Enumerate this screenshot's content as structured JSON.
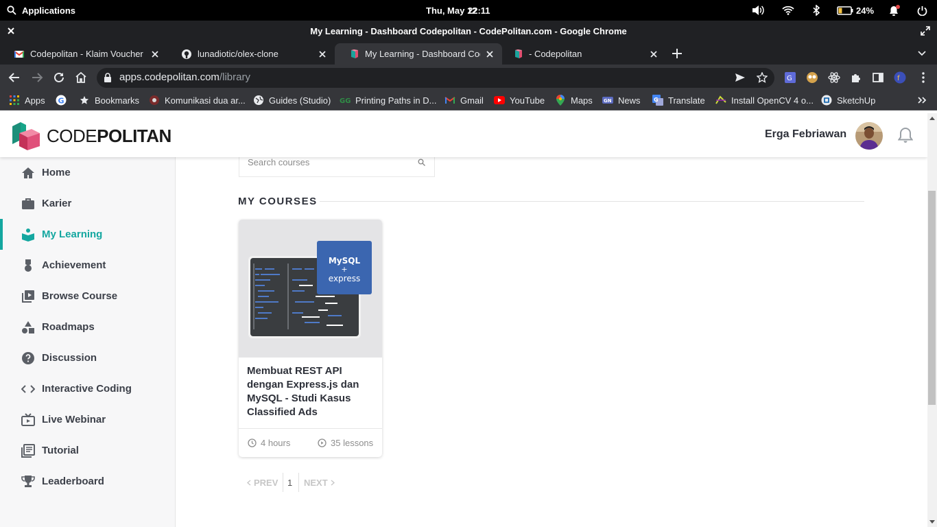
{
  "os_bar": {
    "apps_label": "Applications",
    "date": "Thu, May 12",
    "time": "22:11",
    "battery": "24%"
  },
  "window": {
    "title": "My Learning - Dashboard Codepolitan - CodePolitan.com - Google Chrome"
  },
  "tabs": [
    {
      "label": "Codepolitan - Klaim Voucher - C",
      "icon": "gmail-icon"
    },
    {
      "label": "lunadiotic/olex-clone",
      "icon": "github-icon"
    },
    {
      "label": "My Learning - Dashboard Codepolitan",
      "icon": "codepolitan-icon",
      "active": true
    },
    {
      "label": "- Codepolitan",
      "icon": "codepolitan-icon"
    }
  ],
  "address_bar": {
    "host": "apps.codepolitan.com",
    "path": "/library"
  },
  "bookmarks": [
    {
      "label": "Apps",
      "icon": "apps-grid-icon"
    },
    {
      "label": "",
      "icon": "google-icon"
    },
    {
      "label": "Bookmarks",
      "icon": "star-icon"
    },
    {
      "label": "Komunikasi dua ar...",
      "icon": "bookmark-favicon"
    },
    {
      "label": "Guides (Studio)",
      "icon": "globe-icon"
    },
    {
      "label": "Printing Paths in D...",
      "icon": "gfg-icon"
    },
    {
      "label": "Gmail",
      "icon": "gmail-icon"
    },
    {
      "label": "YouTube",
      "icon": "youtube-icon"
    },
    {
      "label": "Maps",
      "icon": "maps-icon"
    },
    {
      "label": "News",
      "icon": "news-icon"
    },
    {
      "label": "Translate",
      "icon": "translate-icon"
    },
    {
      "label": "Install OpenCV 4 o...",
      "icon": "opencv-icon"
    },
    {
      "label": "SketchUp",
      "icon": "sketchup-icon"
    }
  ],
  "header": {
    "logo_text_light": "CODE",
    "logo_text_bold": "POLITAN",
    "user_name": "Erga Febriawan"
  },
  "sidebar": {
    "items": [
      {
        "label": "Home",
        "icon": "home-icon"
      },
      {
        "label": "Karier",
        "icon": "briefcase-icon"
      },
      {
        "label": "My Learning",
        "icon": "reader-icon",
        "active": true
      },
      {
        "label": "Achievement",
        "icon": "medal-icon"
      },
      {
        "label": "Browse Course",
        "icon": "video-library-icon"
      },
      {
        "label": "Roadmaps",
        "icon": "shapes-icon"
      },
      {
        "label": "Discussion",
        "icon": "help-circle-icon"
      },
      {
        "label": "Interactive Coding",
        "icon": "code-icon"
      },
      {
        "label": "Live Webinar",
        "icon": "tv-icon"
      },
      {
        "label": "Tutorial",
        "icon": "article-icon"
      },
      {
        "label": "Leaderboard",
        "icon": "trophy-icon"
      }
    ]
  },
  "main": {
    "search_placeholder": "Search courses",
    "section_title": "MY COURSES",
    "course": {
      "title": "Membuat REST API dengan Express.js dan MySQL - Studi Kasus Classified Ads",
      "badge_line1": "MySQL",
      "badge_line2": "+",
      "badge_line3": "express",
      "duration": "4 hours",
      "lessons": "35 lessons"
    },
    "pagination": {
      "prev": "PREV",
      "page": "1",
      "next": "NEXT"
    }
  },
  "colors": {
    "accent": "#14a7a0",
    "sidebar_bg": "#f7f7f8",
    "chrome_dark": "#202124",
    "chrome_toolbar": "#35363a",
    "badge_blue": "#3b66b0"
  }
}
